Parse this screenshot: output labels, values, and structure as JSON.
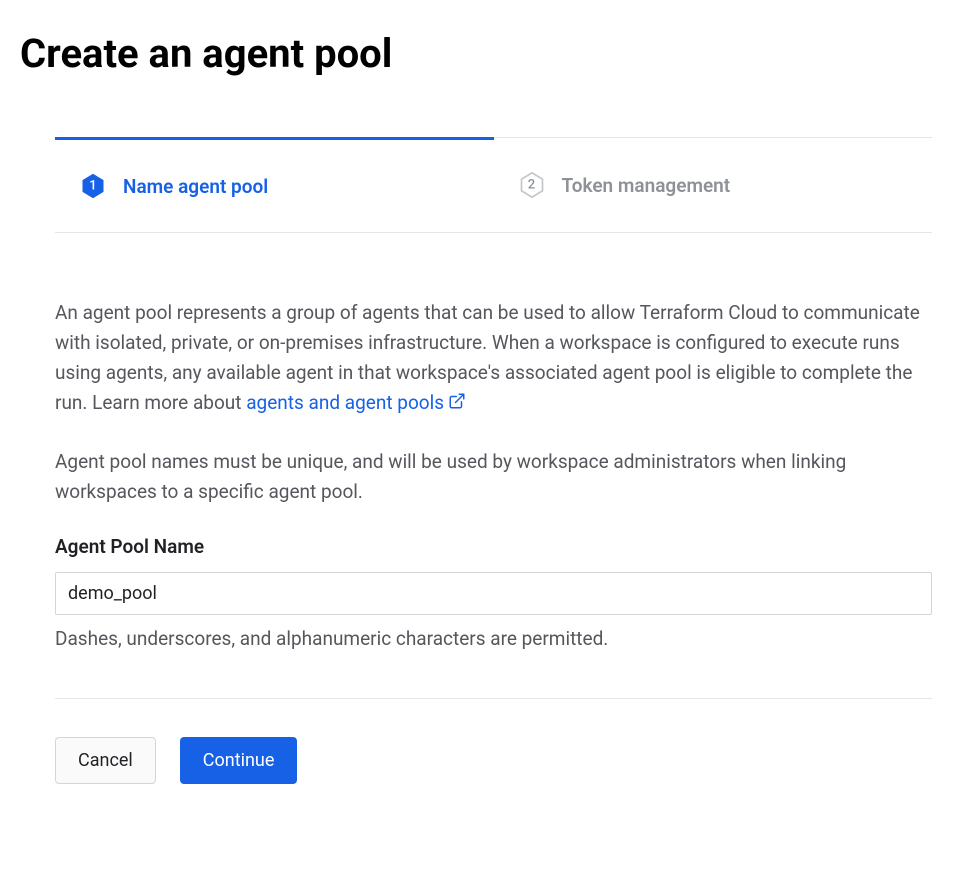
{
  "page": {
    "title": "Create an agent pool"
  },
  "steps": {
    "step1": {
      "number": "1",
      "label": "Name agent pool"
    },
    "step2": {
      "number": "2",
      "label": "Token management"
    }
  },
  "description": {
    "paragraph1_prefix": "An agent pool represents a group of agents that can be used to allow Terraform Cloud to communicate with isolated, private, or on-premises infrastructure. When a workspace is configured to execute runs using agents, any available agent in that workspace's associated agent pool is eligible to complete the run. Learn more about ",
    "link_text": "agents and agent pools",
    "paragraph2": "Agent pool names must be unique, and will be used by workspace administrators when linking workspaces to a specific agent pool."
  },
  "form": {
    "name_label": "Agent Pool Name",
    "name_value": "demo_pool",
    "name_hint": "Dashes, underscores, and alphanumeric characters are permitted."
  },
  "buttons": {
    "cancel": "Cancel",
    "continue": "Continue"
  }
}
